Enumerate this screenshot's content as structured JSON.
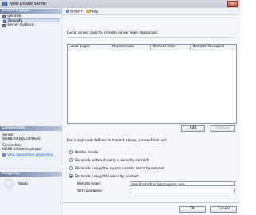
{
  "window": {
    "title": "New Linked Server",
    "close_glyph": "✕"
  },
  "sidebar": {
    "select_page_heading": "Select a page",
    "pages": [
      {
        "label": "General",
        "selected": false
      },
      {
        "label": "Security",
        "selected": true
      },
      {
        "label": "Server Options",
        "selected": false
      }
    ],
    "connection": {
      "heading": "Connection",
      "server_label": "Server:",
      "server_value": "W2K8-64\\SQLEXPRESS",
      "connection_label": "Connection:",
      "connection_value": "W2K8-64\\Administrator",
      "view_link": "View connection properties"
    },
    "progress": {
      "heading": "Progress",
      "status": "Ready"
    }
  },
  "toolbar": {
    "script_label": "Script",
    "help_label": "Help"
  },
  "main": {
    "mappings_label": "Local server login to remote server login mappings:",
    "columns": [
      "Local Login",
      "Impersonate",
      "Remote User",
      "Remote Password"
    ],
    "add_button": "Add",
    "remove_button": "Remove",
    "login_not_defined_label": "For a login not defined in the list above, connections will:",
    "options": [
      {
        "label": "Not be made",
        "selected": false
      },
      {
        "label": "Be made without using a security context",
        "selected": false
      },
      {
        "label": "Be made using the login's current security context",
        "selected": false
      },
      {
        "label": "Be made using this security context:",
        "selected": true
      }
    ],
    "remote_login_label": "Remote login:",
    "remote_login_value": "zuesit.sandbox2@progress.com",
    "password_label": "With password:",
    "password_value": ""
  },
  "footer": {
    "ok_button": "OK",
    "cancel_button": "Cancel"
  }
}
